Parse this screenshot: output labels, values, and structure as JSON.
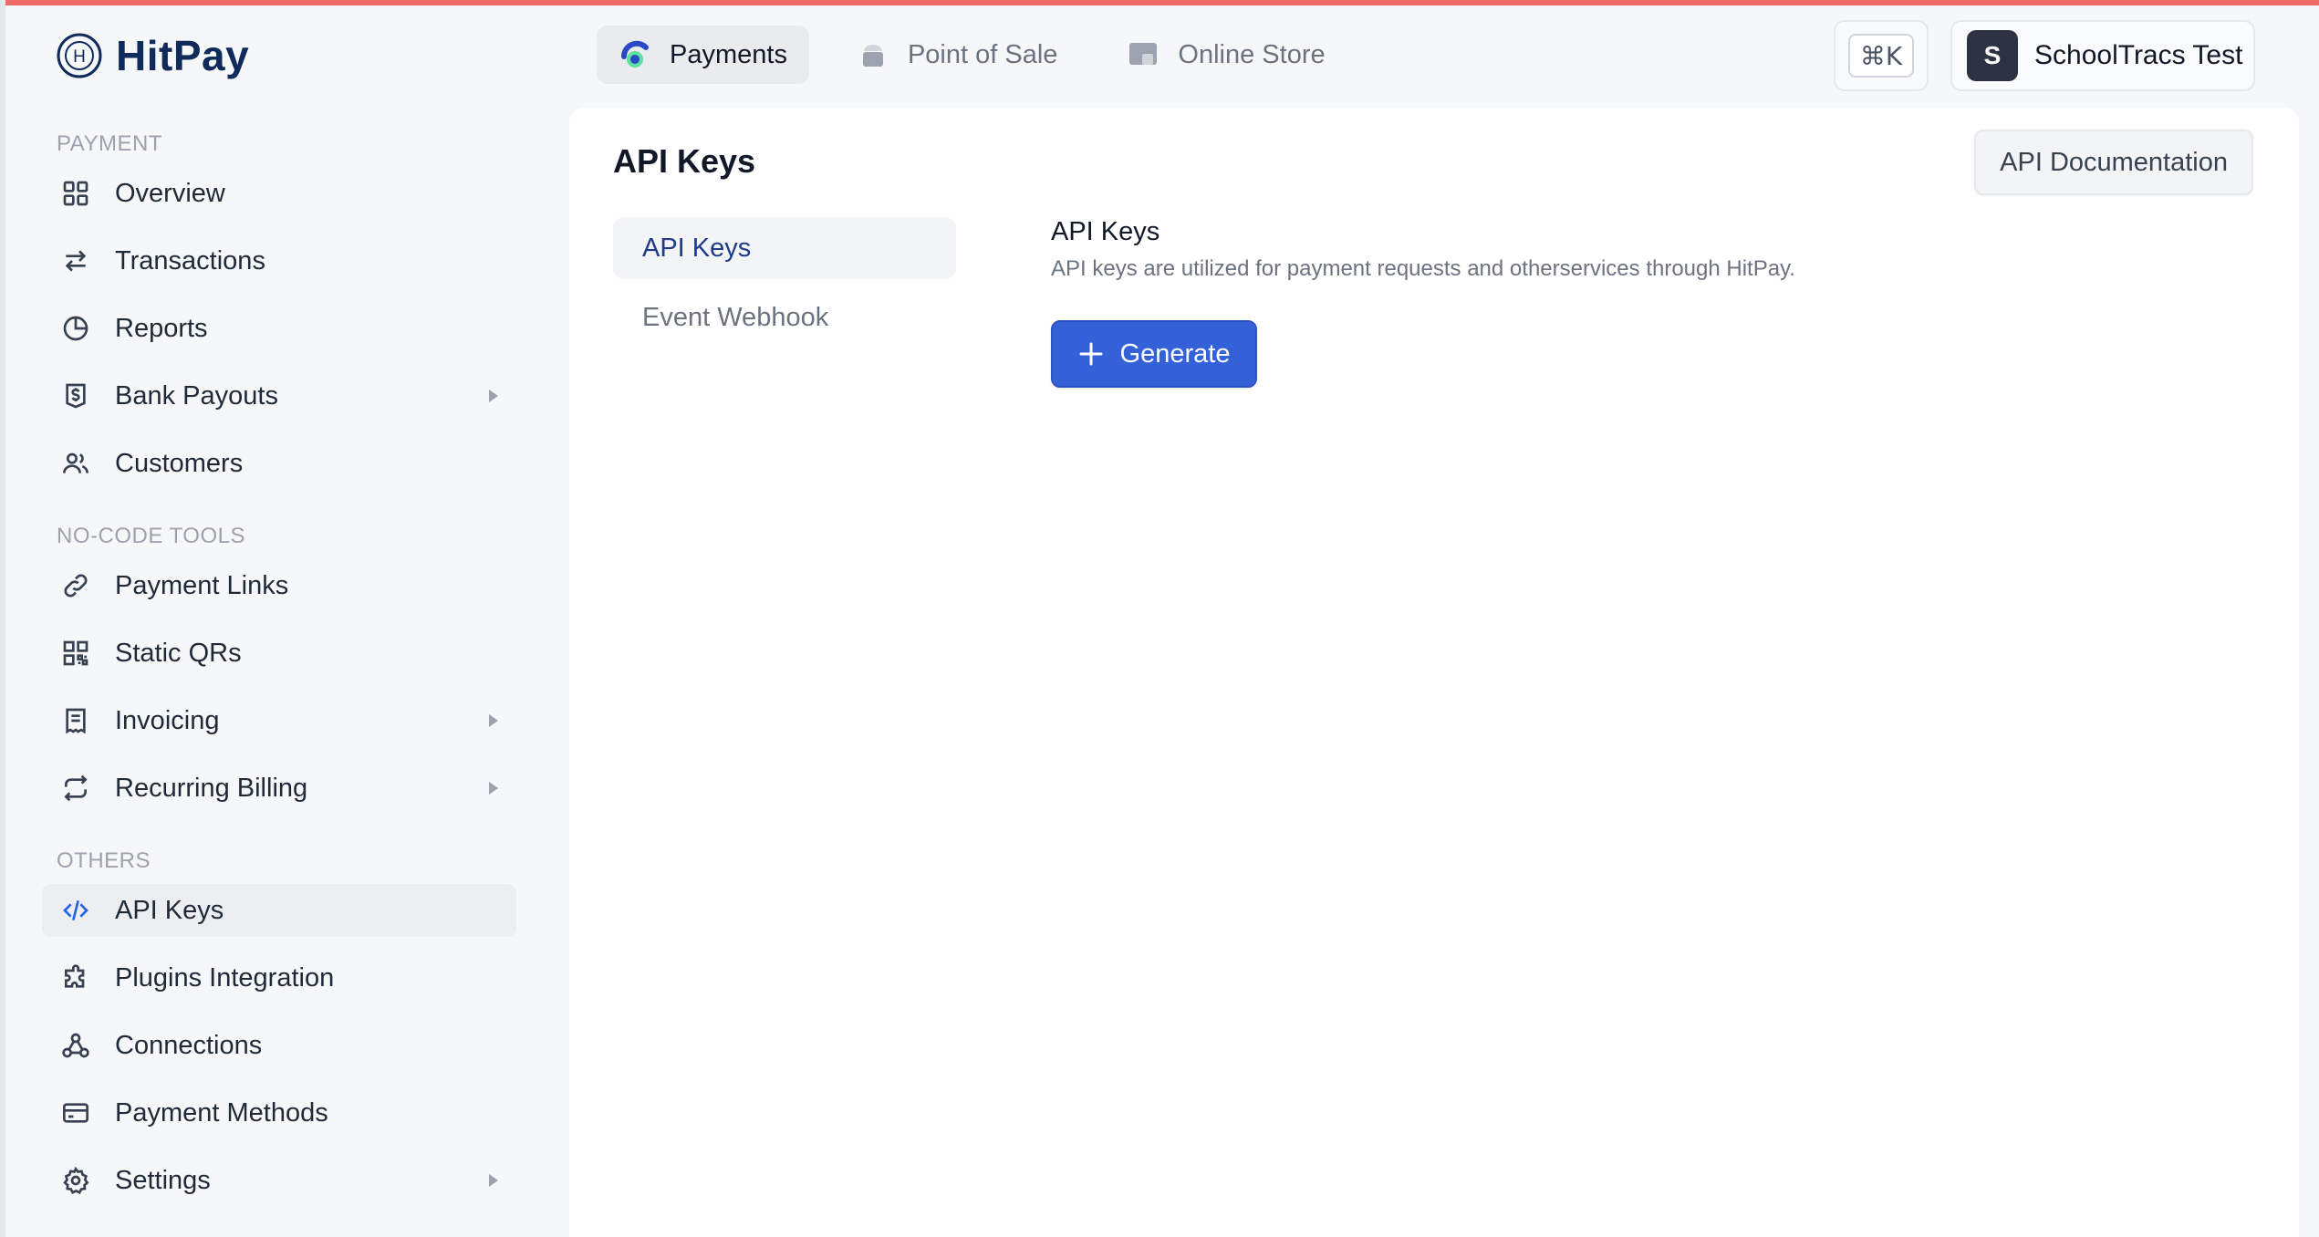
{
  "brand": {
    "name": "HitPay",
    "logo_letter": "H"
  },
  "top_nav": {
    "tabs": [
      {
        "label": "Payments",
        "icon": "payments-icon",
        "active": true
      },
      {
        "label": "Point of Sale",
        "icon": "pos-icon",
        "active": false
      },
      {
        "label": "Online Store",
        "icon": "store-icon",
        "active": false
      }
    ],
    "command_shortcut": "⌘K",
    "account": {
      "initial": "S",
      "name": "SchoolTracs Test"
    }
  },
  "sidebar": {
    "sections": [
      {
        "label": "PAYMENT"
      },
      {
        "label": "NO-CODE TOOLS"
      },
      {
        "label": "OTHERS"
      }
    ],
    "items": [
      {
        "label": "Overview",
        "icon": "grid-icon"
      },
      {
        "label": "Transactions",
        "icon": "arrows-swap-icon"
      },
      {
        "label": "Reports",
        "icon": "pie-chart-icon"
      },
      {
        "label": "Bank Payouts",
        "icon": "dollar-shield-icon",
        "has_submenu": true
      },
      {
        "label": "Customers",
        "icon": "users-icon"
      },
      {
        "label": "Payment Links",
        "icon": "link-icon"
      },
      {
        "label": "Static QRs",
        "icon": "qr-icon"
      },
      {
        "label": "Invoicing",
        "icon": "receipt-icon",
        "has_submenu": true
      },
      {
        "label": "Recurring Billing",
        "icon": "repeat-icon",
        "has_submenu": true
      },
      {
        "label": "API Keys",
        "icon": "code-icon",
        "active": true
      },
      {
        "label": "Plugins Integration",
        "icon": "puzzle-icon"
      },
      {
        "label": "Connections",
        "icon": "network-icon"
      },
      {
        "label": "Payment Methods",
        "icon": "card-icon"
      },
      {
        "label": "Settings",
        "icon": "gear-icon",
        "has_submenu": true
      }
    ]
  },
  "main": {
    "title": "API Keys",
    "doc_button": "API Documentation",
    "subnav": [
      {
        "label": "API Keys",
        "active": true
      },
      {
        "label": "Event Webhook",
        "active": false
      }
    ],
    "content": {
      "title": "API Keys",
      "description": "API keys are utilized for payment requests and otherservices through HitPay.",
      "generate_button": "Generate"
    }
  },
  "colors": {
    "accent": "#3461d8",
    "brand_navy": "#0f2a5b",
    "top_strip": "#ef6b68"
  }
}
